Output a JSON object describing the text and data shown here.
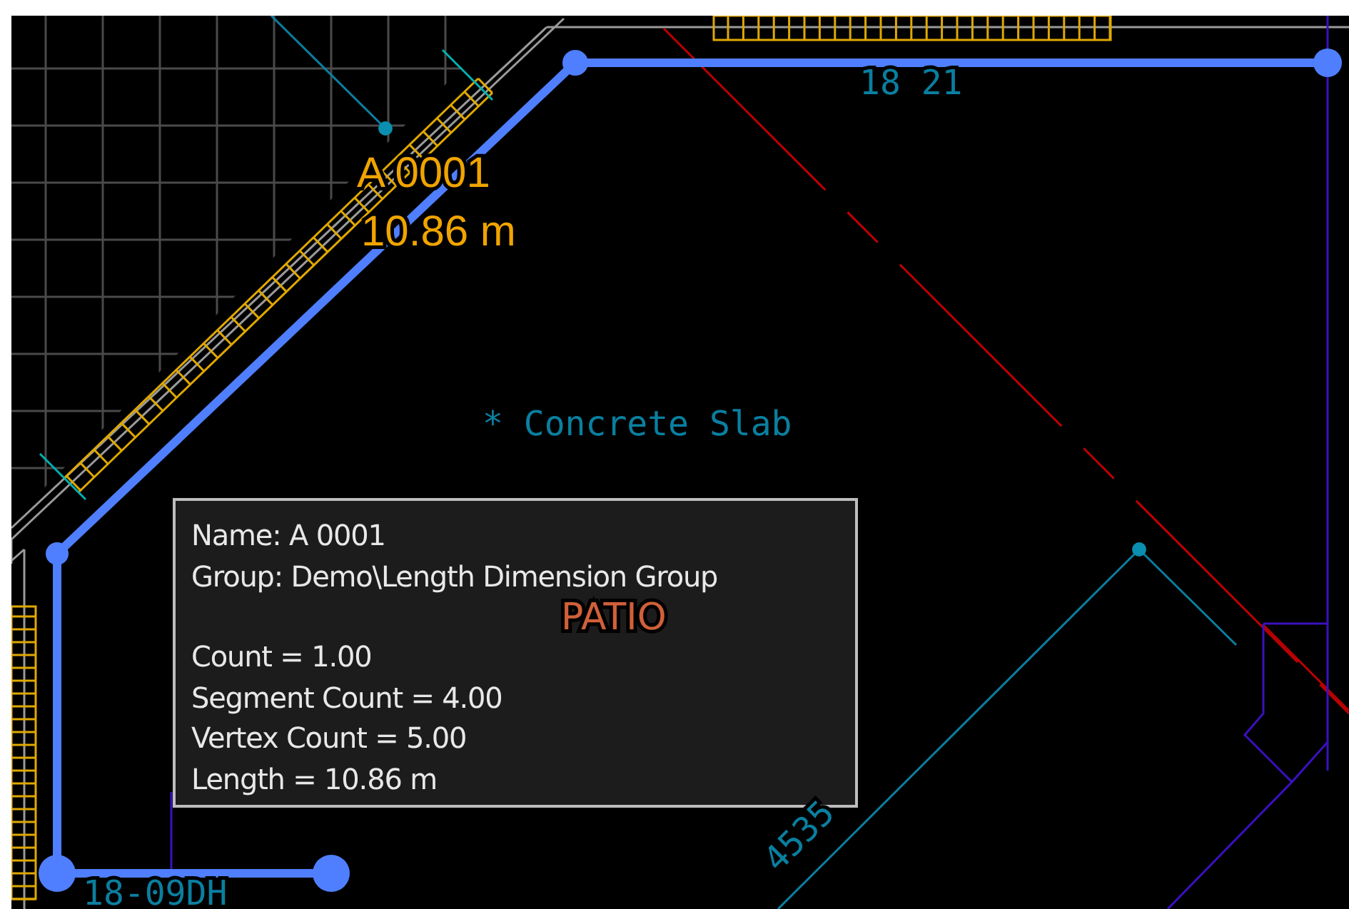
{
  "drawing": {
    "labels": [
      {
        "kind": "selection",
        "text": "A 0001"
      },
      {
        "kind": "selection",
        "text": "10.86 m"
      },
      {
        "kind": "note",
        "text": "* Concrete Slab"
      },
      {
        "kind": "room",
        "text": "PATIO"
      },
      {
        "kind": "dimension",
        "text": "18 21"
      },
      {
        "kind": "dimension",
        "text": "18-09DH"
      },
      {
        "kind": "dimension",
        "text": "4535"
      }
    ]
  },
  "tooltip": {
    "sections": [
      {
        "lines": [
          "Name: A 0001",
          "Group: Demo\\Length Dimension Group"
        ]
      },
      {
        "lines": [
          "Count = 1.00",
          "Segment Count = 4.00",
          "Vertex Count = 5.00",
          "Length = 10.86 m"
        ]
      }
    ]
  }
}
